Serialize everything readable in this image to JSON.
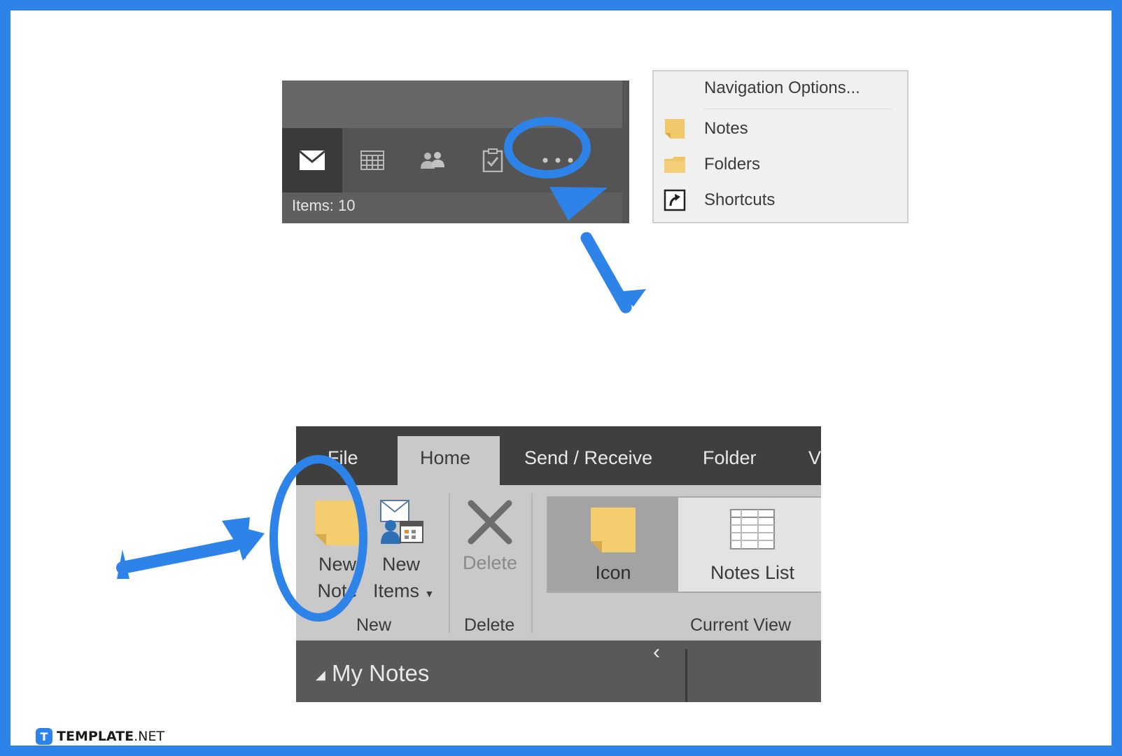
{
  "nav": {
    "status": "Items: 10",
    "buttons": [
      {
        "icon": "mail-icon",
        "active": true
      },
      {
        "icon": "calendar-icon"
      },
      {
        "icon": "people-icon"
      },
      {
        "icon": "tasks-icon"
      },
      {
        "icon": "more-icon"
      }
    ]
  },
  "menu": {
    "items": [
      {
        "label": "Navigation Options...",
        "icon": ""
      },
      {
        "label": "Notes",
        "icon": "note-icon",
        "color": "#f2c96a"
      },
      {
        "label": "Folders",
        "icon": "folder-icon",
        "color": "#f0c56a"
      },
      {
        "label": "Shortcuts",
        "icon": "shortcut-icon"
      }
    ]
  },
  "ribbon": {
    "tabs": [
      "File",
      "Home",
      "Send / Receive",
      "Folder",
      "V"
    ],
    "new_note": [
      "New",
      "Note"
    ],
    "new_items": [
      "New",
      "Items"
    ],
    "delete": "Delete",
    "groups": {
      "new": "New",
      "delete": "Delete",
      "current_view": "Current View"
    },
    "views": {
      "icon": "Icon",
      "notes_list": "Notes List"
    },
    "pane_title": "My Notes"
  },
  "colors": {
    "accent": "#2e83e8",
    "note": "#f4cd6e"
  },
  "footer": {
    "brand": "TEMPLATE",
    "suffix": ".NET"
  }
}
